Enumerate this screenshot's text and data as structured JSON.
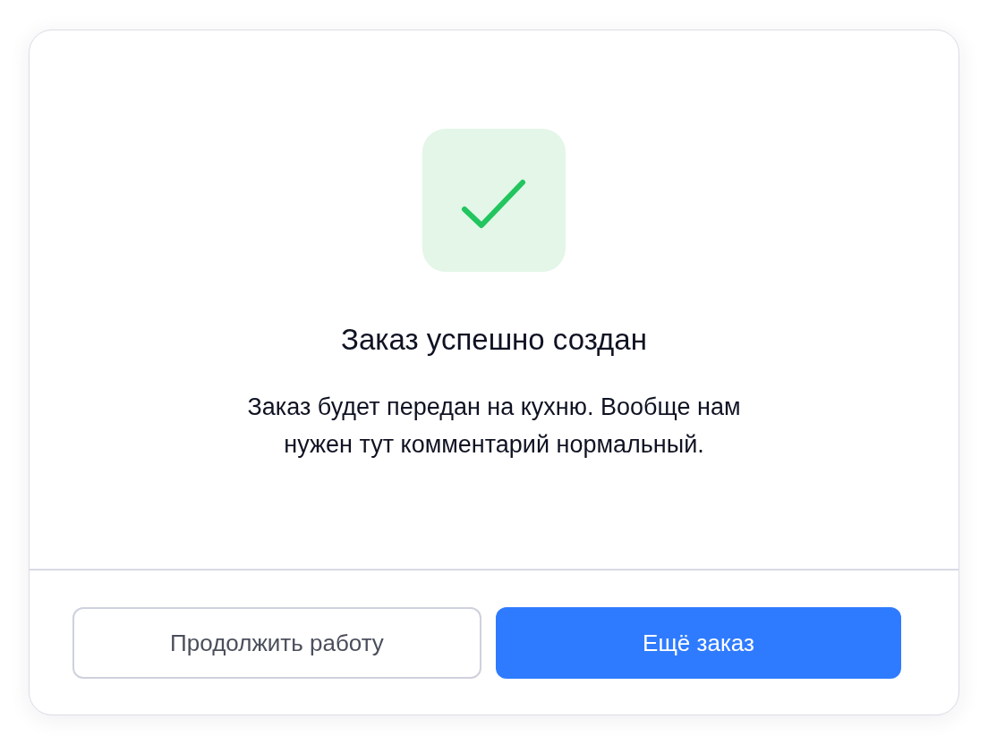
{
  "dialog": {
    "title": "Заказ успешно создан",
    "message": "Заказ будет передан на кухню. Вообще нам нужен тут комментарий нормальный.",
    "success": true,
    "buttons": [
      {
        "label": "Продолжить работу",
        "kind": "secondary"
      },
      {
        "label": "Ещё заказ",
        "kind": "primary"
      }
    ]
  }
}
